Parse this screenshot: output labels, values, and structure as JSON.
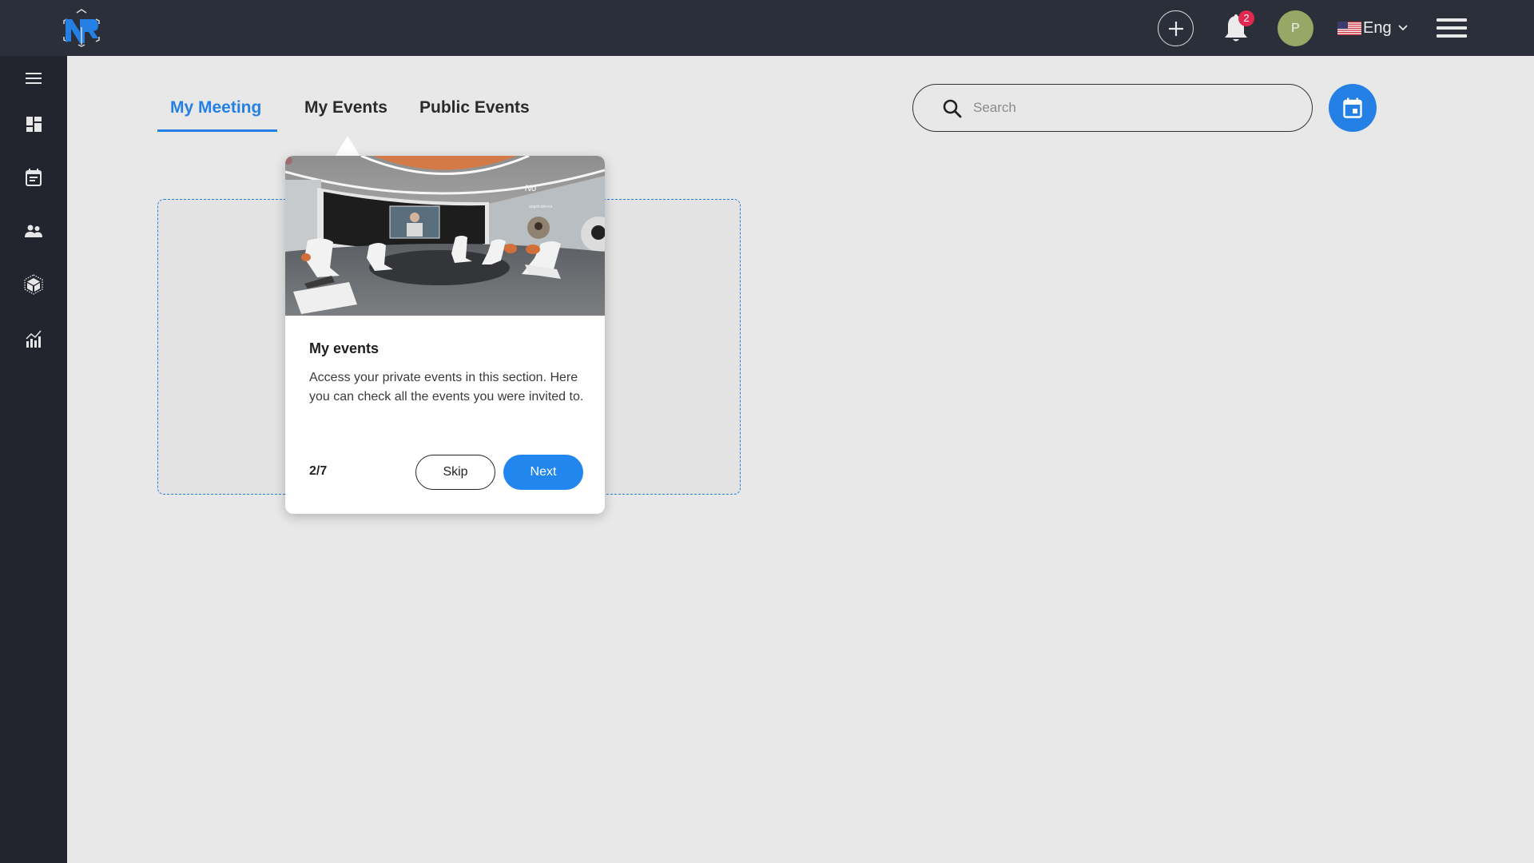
{
  "header": {
    "logo_alt": "NR logo",
    "add_button_label": "+",
    "notifications": {
      "count": "2"
    },
    "user": {
      "initial": "P"
    },
    "language": {
      "label": "Eng",
      "flag": "us-flag-icon"
    },
    "menu_icon": "hamburger-icon"
  },
  "sidebar": {
    "items": [
      {
        "name": "menu",
        "icon": "hamburger-icon"
      },
      {
        "name": "dashboard",
        "icon": "dashboard-icon"
      },
      {
        "name": "events",
        "icon": "calendar-icon"
      },
      {
        "name": "users",
        "icon": "people-icon"
      },
      {
        "name": "3d-spaces",
        "icon": "cube-icon"
      },
      {
        "name": "analytics",
        "icon": "chart-icon"
      }
    ]
  },
  "tabs": [
    {
      "label": "My Meeting",
      "active": true
    },
    {
      "label": "My Events",
      "active": false
    },
    {
      "label": "Public Events",
      "active": false
    }
  ],
  "search": {
    "placeholder": "Search",
    "value": ""
  },
  "calendar_button": {
    "icon": "calendar-icon"
  },
  "colors": {
    "accent": "#2480e4",
    "header_bg": "#2a2f3a",
    "sidebar_bg": "#22252d",
    "badge": "#e0294f",
    "avatar": "#95a865"
  },
  "tour": {
    "image_alt": "Virtual 3D meeting room",
    "image_overlay_text": "No",
    "image_name_tag": "angelcabrera",
    "title": "My events",
    "body": "Access your private events in this section. Here you can check all the events you were invited to.",
    "step": "2/7",
    "skip_label": "Skip",
    "next_label": "Next"
  }
}
